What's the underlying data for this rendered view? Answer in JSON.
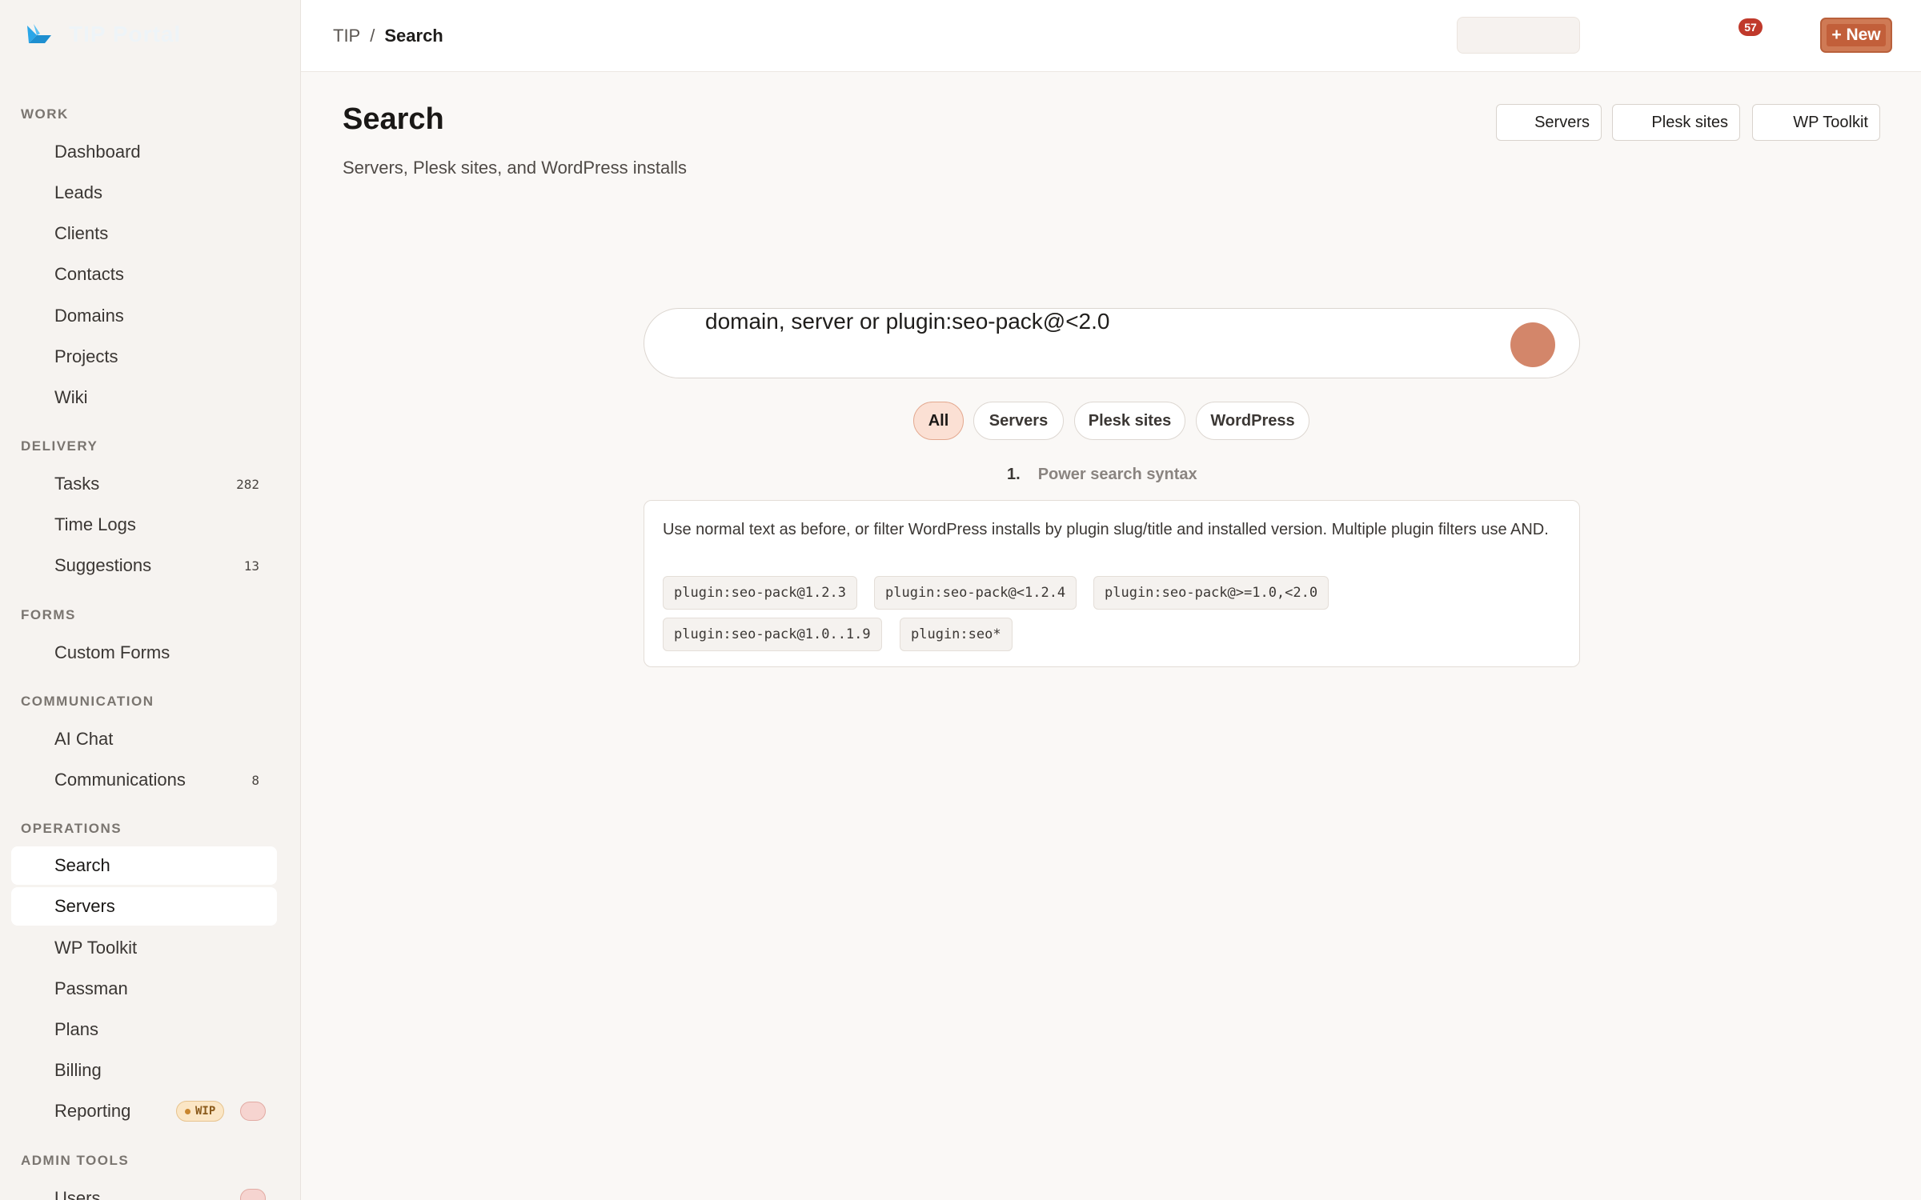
{
  "brand": {
    "name": "TIP Portal"
  },
  "sidebar": {
    "sections": [
      {
        "title": "WORK",
        "items": [
          {
            "label": "Dashboard"
          },
          {
            "label": "Leads"
          },
          {
            "label": "Clients"
          },
          {
            "label": "Contacts"
          },
          {
            "label": "Domains"
          },
          {
            "label": "Projects"
          },
          {
            "label": "Wiki"
          }
        ]
      },
      {
        "title": "DELIVERY",
        "items": [
          {
            "label": "Tasks",
            "count": "282"
          },
          {
            "label": "Time Logs"
          },
          {
            "label": "Suggestions",
            "count": "13"
          }
        ]
      },
      {
        "title": "FORMS",
        "items": [
          {
            "label": "Custom Forms"
          }
        ]
      },
      {
        "title": "COMMUNICATION",
        "items": [
          {
            "label": "AI Chat"
          },
          {
            "label": "Communications",
            "count": "8"
          }
        ]
      },
      {
        "title": "OPERATIONS",
        "items": [
          {
            "label": "Search"
          },
          {
            "label": "Servers"
          },
          {
            "label": "WP Toolkit"
          },
          {
            "label": "Passman"
          },
          {
            "label": "Plans"
          },
          {
            "label": "Billing"
          },
          {
            "label": "Reporting",
            "badge": "WIP"
          }
        ]
      },
      {
        "title": "ADMIN TOOLS",
        "items": [
          {
            "label": "Users"
          }
        ]
      }
    ]
  },
  "topbar": {
    "breadcrumb": {
      "root": "TIP",
      "separator": "/",
      "current": "Search"
    },
    "notifications_count": "57",
    "new_button_label": "+ New"
  },
  "main": {
    "title": "Search",
    "subtitle": "Servers, Plesk sites, and WordPress installs",
    "header_buttons": [
      "Servers",
      "Plesk sites",
      "WP Toolkit"
    ],
    "search": {
      "value": "domain, server or plugin:seo-pack@<2.0"
    },
    "filters": [
      "All",
      "Servers",
      "Plesk sites",
      "WordPress"
    ],
    "syntax": {
      "number": "1.",
      "heading": "Power search syntax",
      "description": "Use normal text as before, or filter WordPress installs by plugin slug/title and installed version. Multiple plugin filters use AND.",
      "examples": [
        "plugin:seo-pack@1.2.3",
        "plugin:seo-pack@<1.2.4",
        "plugin:seo-pack@>=1.0,<2.0",
        "plugin:seo-pack@1.0..1.9",
        "plugin:seo*"
      ]
    }
  },
  "colors": {
    "accent": "#cf7a55",
    "notification": "#c0392b",
    "selected_chip": "#fbe0d4",
    "brand_icon": "#2aa6e8"
  }
}
